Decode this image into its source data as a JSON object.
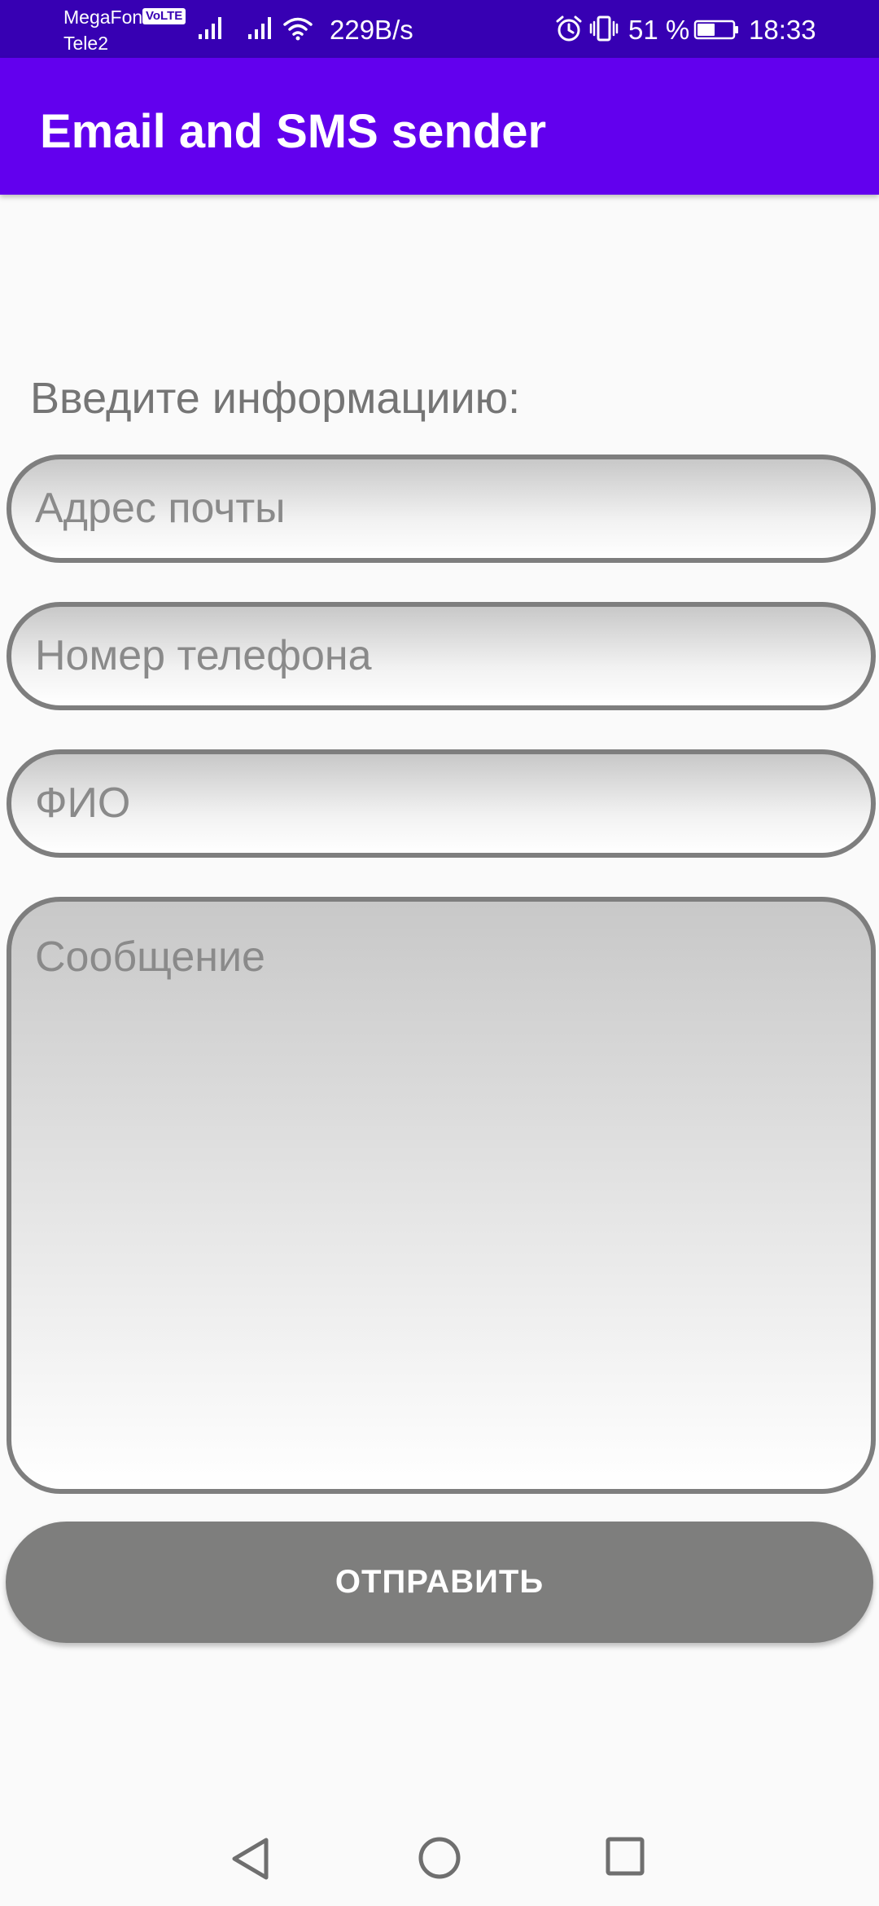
{
  "status_bar": {
    "carrier_primary": "MegaFon",
    "volte_badge": "VoLTE",
    "carrier_secondary": "Tele2",
    "network_speed": "229B/s",
    "battery_percent": "51 %",
    "battery_level": 0.51,
    "time": "18:33",
    "icons": [
      "signal-icon",
      "signal-icon",
      "wifi-icon",
      "alarm-icon",
      "vibrate-icon",
      "battery-icon"
    ]
  },
  "app_bar": {
    "title": "Email and SMS sender"
  },
  "form": {
    "label": "Введите информациию:",
    "email_placeholder": "Адрес почты",
    "phone_placeholder": "Номер телефона",
    "name_placeholder": "ФИО",
    "message_placeholder": "Сообщение",
    "send_label": "ОТПРАВИТЬ"
  },
  "nav_bar": {
    "icons": [
      "back-icon",
      "home-icon",
      "recents-icon"
    ]
  },
  "colors": {
    "status_bar": "#3700B3",
    "app_bar": "#6200EE",
    "background": "#FAFAFA",
    "field_border": "#7E7E7E",
    "button": "#7E7E7D",
    "text_gray": "#757575"
  }
}
